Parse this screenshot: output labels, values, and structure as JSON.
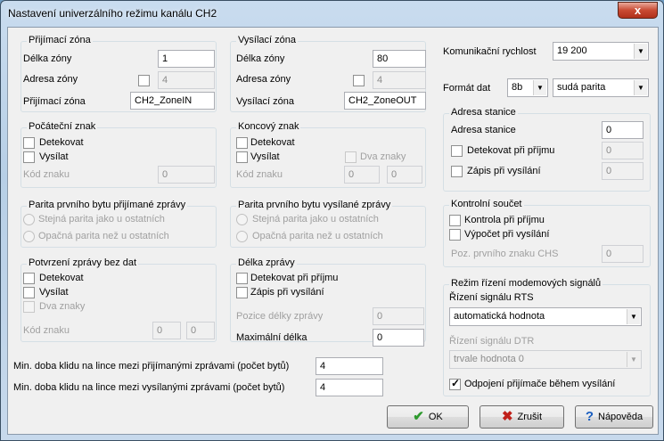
{
  "window": {
    "title": "Nastavení univerzálního režimu kanálu CH2",
    "close_label": "x"
  },
  "rx_zone": {
    "legend": "Přijímací zóna",
    "length_label": "Délka zóny",
    "length_value": "1",
    "address_label": "Adresa zóny",
    "address_value": "4",
    "zone_label": "Přijímací zóna",
    "zone_value": "CH2_ZoneIN"
  },
  "tx_zone": {
    "legend": "Vysílací zóna",
    "length_label": "Délka zóny",
    "length_value": "80",
    "address_label": "Adresa zóny",
    "address_value": "4",
    "zone_label": "Vysílací zóna",
    "zone_value": "CH2_ZoneOUT"
  },
  "start_char": {
    "legend": "Počáteční znak",
    "detect": "Detekovat",
    "send": "Vysílat",
    "code_label": "Kód znaku",
    "code_value": "0"
  },
  "end_char": {
    "legend": "Koncový znak",
    "detect": "Detekovat",
    "send": "Vysílat",
    "two_chars": "Dva znaky",
    "code_label": "Kód znaku",
    "code1": "0",
    "code2": "0"
  },
  "rx_parity": {
    "legend": "Parita prvního bytu přijímané zprávy",
    "same": "Stejná parita jako u ostatních",
    "opposite": "Opačná parita než u ostatních"
  },
  "tx_parity": {
    "legend": "Parita prvního bytu vysílané zprávy",
    "same": "Stejná parita jako u ostatních",
    "opposite": "Opačná parita než u ostatních"
  },
  "ack": {
    "legend": "Potvrzení zprávy bez dat",
    "detect": "Detekovat",
    "send": "Vysílat",
    "two_chars": "Dva znaky",
    "code_label": "Kód znaku",
    "code1": "0",
    "code2": "0"
  },
  "msg_len": {
    "legend": "Délka zprávy",
    "detect": "Detekovat při příjmu",
    "write": "Zápis při vysílání",
    "pos_label": "Pozice délky zprávy",
    "pos_value": "0",
    "max_label": "Maximální délka",
    "max_value": "0"
  },
  "idle": {
    "rx_label": "Min. doba klidu na lince mezi přijímanými zprávami (počet bytů)",
    "rx_value": "4",
    "tx_label": "Min. doba klidu na lince mezi vysílanými zprávami (počet bytů)",
    "tx_value": "4"
  },
  "comm": {
    "speed_label": "Komunikační rychlost",
    "speed_value": "19 200",
    "format_label": "Formát dat",
    "bits_value": "8b",
    "parity_value": "sudá parita"
  },
  "station": {
    "legend": "Adresa stanice",
    "address_label": "Adresa stanice",
    "address_value": "0",
    "detect": "Detekovat při příjmu",
    "detect_value": "0",
    "write": "Zápis při vysílání",
    "write_value": "0"
  },
  "checksum": {
    "legend": "Kontrolní součet",
    "check": "Kontrola při příjmu",
    "calc": "Výpočet při vysílání",
    "pos_label": "Poz. prvního znaku CHS",
    "pos_value": "0"
  },
  "modem": {
    "legend": "Režim řízení modemových signálů",
    "rts_label": "Řízení signálu RTS",
    "rts_value": "automatická hodnota",
    "dtr_label": "Řízení signálu DTR",
    "dtr_value": "trvale hodnota 0",
    "disconnect": "Odpojení přijímače během vysílání"
  },
  "buttons": {
    "ok": "OK",
    "cancel": "Zrušit",
    "help": "Nápověda"
  }
}
